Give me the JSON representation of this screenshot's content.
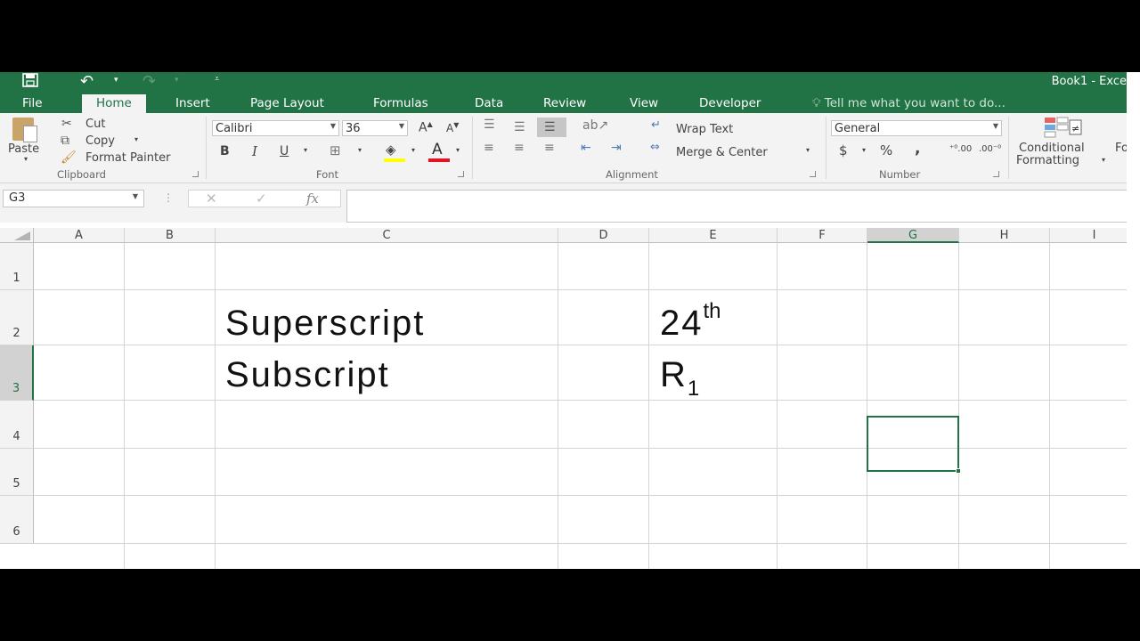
{
  "titlebar": {
    "title": "Book1 - Exce",
    "icons": [
      "save-icon",
      "undo-icon",
      "redo-icon",
      "customize-qat-icon"
    ]
  },
  "tabs": {
    "file": "File",
    "home": "Home",
    "insert": "Insert",
    "page_layout": "Page Layout",
    "formulas": "Formulas",
    "data": "Data",
    "review": "Review",
    "view": "View",
    "developer": "Developer",
    "tell_me": "Tell me what you want to do..."
  },
  "ribbon": {
    "clipboard": {
      "paste": "Paste",
      "cut": "Cut",
      "copy": "Copy",
      "format_painter": "Format Painter",
      "label": "Clipboard"
    },
    "font": {
      "family": "Calibri",
      "size": "36",
      "bold": "B",
      "italic": "I",
      "underline": "U",
      "grow": "A",
      "shrink": "A",
      "font_color": "A",
      "label": "Font"
    },
    "alignment": {
      "wrap_text": "Wrap Text",
      "merge_center": "Merge & Center",
      "label": "Alignment"
    },
    "number": {
      "format": "General",
      "currency": "$",
      "percent": "%",
      "comma": ",",
      "label": "Number"
    },
    "styles": {
      "conditional_line1": "Conditional",
      "conditional_line2": "Formatting",
      "next_cut": "Fo"
    },
    "colors": {
      "accent": "#217346",
      "highlight": "#ffff00",
      "font_color": "#ff0000"
    }
  },
  "formula_bar": {
    "name_box": "G3",
    "cancel": "✕",
    "enter": "✓",
    "fx": "fx",
    "content": ""
  },
  "grid": {
    "columns": [
      "A",
      "B",
      "C",
      "D",
      "E",
      "F",
      "G",
      "H",
      "I"
    ],
    "rows": [
      "1",
      "2",
      "3",
      "4",
      "5",
      "6"
    ],
    "selected_cell": "G3",
    "cells": {
      "C2": "Superscript",
      "C3": "Subscript",
      "E2_base": "24",
      "E2_sup": "th",
      "E3_base": "R",
      "E3_sub": "1"
    }
  }
}
